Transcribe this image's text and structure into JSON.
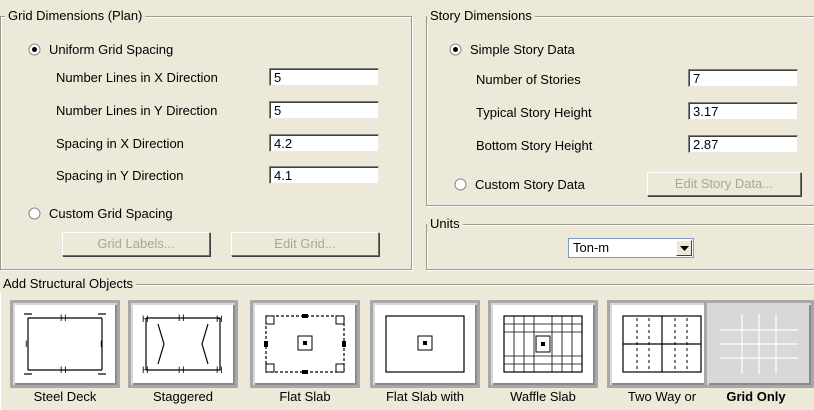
{
  "grid_dimensions": {
    "title": "Grid Dimensions (Plan)",
    "uniform_label": "Uniform Grid Spacing",
    "uniform_selected": true,
    "fields": [
      {
        "label": "Number Lines in X Direction",
        "value": "5"
      },
      {
        "label": "Number Lines in Y Direction",
        "value": "5"
      },
      {
        "label": "Spacing in X Direction",
        "value": "4.2"
      },
      {
        "label": "Spacing in Y Direction",
        "value": "4.1"
      }
    ],
    "custom_label": "Custom Grid Spacing",
    "grid_labels_button": "Grid Labels...",
    "edit_grid_button": "Edit Grid..."
  },
  "story_dimensions": {
    "title": "Story Dimensions",
    "simple_label": "Simple Story Data",
    "simple_selected": true,
    "fields": [
      {
        "label": "Number of Stories",
        "value": "7"
      },
      {
        "label": "Typical Story Height",
        "value": "3.17"
      },
      {
        "label": "Bottom Story Height",
        "value": "2.87"
      }
    ],
    "custom_label": "Custom Story Data",
    "edit_story_button": "Edit Story Data..."
  },
  "units": {
    "title": "Units",
    "selected": "Ton-m"
  },
  "structural_objects": {
    "title": "Add Structural Objects",
    "items": [
      {
        "label": "Steel Deck",
        "icon": "steel-deck-icon"
      },
      {
        "label": "Staggered",
        "icon": "staggered-truss-icon"
      },
      {
        "label": "Flat Slab",
        "icon": "flat-slab-icon"
      },
      {
        "label": "Flat Slab with",
        "icon": "flat-slab-perimeter-icon"
      },
      {
        "label": "Waffle Slab",
        "icon": "waffle-slab-icon"
      },
      {
        "label": "Two Way or",
        "icon": "two-way-slab-icon"
      },
      {
        "label": "Grid Only",
        "icon": "grid-only-icon",
        "selected": true
      }
    ]
  }
}
